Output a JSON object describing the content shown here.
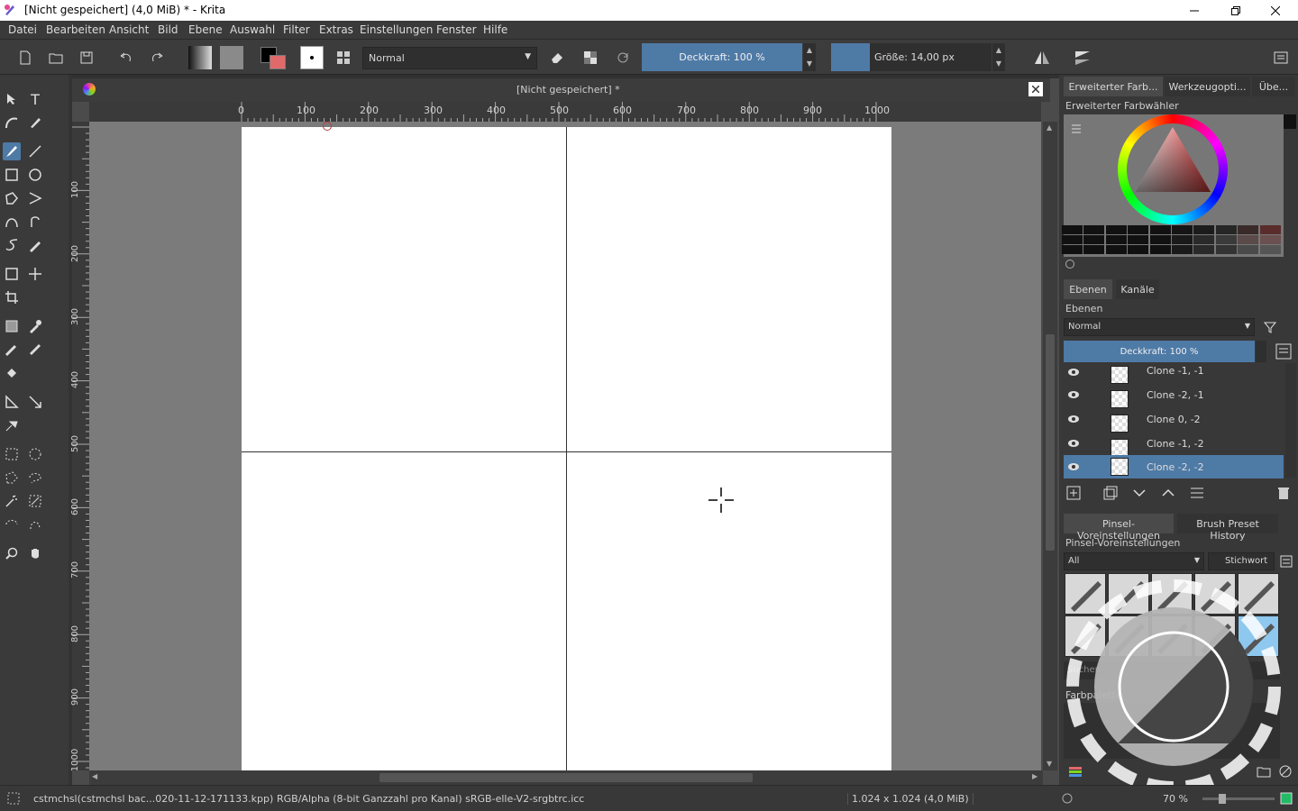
{
  "window": {
    "title": "[Nicht gespeichert]  (4,0 MiB)  * - Krita"
  },
  "menu": [
    "Datei",
    "Bearbeiten",
    "Ansicht",
    "Bild",
    "Ebene",
    "Auswahl",
    "Filter",
    "Extras",
    "Einstellungen",
    "Fenster",
    "Hilfe"
  ],
  "toolbar": {
    "blend_mode": "Normal",
    "opacity_label": "Deckkraft: 100 %",
    "size_label": "Größe: 14,00 px"
  },
  "document": {
    "tab_title": "[Nicht gespeichert]  *"
  },
  "ruler_h": [
    "0",
    "100",
    "200",
    "300",
    "400",
    "500",
    "600",
    "700",
    "800",
    "900",
    "1000"
  ],
  "ruler_v": [
    "100",
    "200",
    "300",
    "400",
    "500",
    "600",
    "700",
    "800",
    "900",
    "1000"
  ],
  "right_panel": {
    "top_tabs": [
      "Erweiterter Farb...",
      "Werkzeugopti...",
      "Übe..."
    ],
    "color_selector_label": "Erweiterter Farbwähler",
    "layer_tabs": [
      "Ebenen",
      "Kanäle"
    ],
    "layers_label": "Ebenen",
    "layer_blend": "Normal",
    "layer_opacity": "Deckkraft:  100 %",
    "layers": [
      "Clone -1, -1",
      "Clone -2, -1",
      "Clone 0, -2",
      "Clone -1, -2",
      "Clone -2, -2"
    ],
    "brush_tabs": [
      "Pinsel-Voreinstellungen",
      "Brush Preset History"
    ],
    "brush_label": "Pinsel-Voreinstellungen",
    "brush_filter": "All",
    "brush_tag": "Stichwort",
    "search_label": "Suchen",
    "palette_label": "Farbpalette"
  },
  "status": {
    "file": "cstmchsl(cstmchsl bac...020-11-12-171133.kpp)",
    "color_profile": "RGB/Alpha (8-bit Ganzzahl pro Kanal)  sRGB-elle-V2-srgbtrc.icc",
    "dimensions": "1.024 x 1.024 (4,0 MiB)",
    "zoom": "70 %"
  },
  "colors": {
    "accent": "#4e7aa6",
    "fg_color": "#000000",
    "bg_color": "#e06a6a"
  }
}
